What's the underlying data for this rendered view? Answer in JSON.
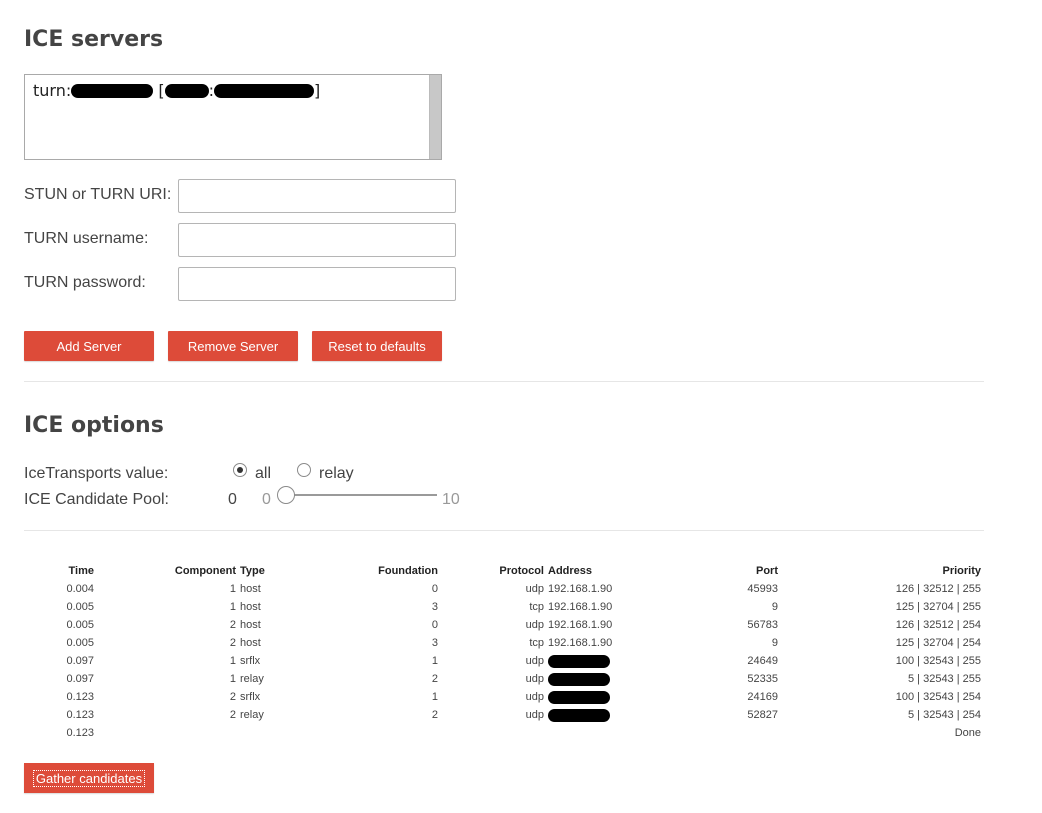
{
  "servers": {
    "title": "ICE servers",
    "list_item": {
      "prefix": "turn:",
      "bracket_open": "[",
      "colon": ":",
      "bracket_close": "]"
    },
    "uri_label": "STUN or TURN URI:",
    "username_label": "TURN username:",
    "password_label": "TURN password:",
    "uri_value": "",
    "username_value": "",
    "password_value": "",
    "add_label": "Add Server",
    "remove_label": "Remove Server",
    "reset_label": "Reset to defaults"
  },
  "options": {
    "title": "ICE options",
    "transports_label": "IceTransports value:",
    "transport_all": "all",
    "transport_relay": "relay",
    "selected_transport": "all",
    "pool_label": "ICE Candidate Pool:",
    "pool_value": "0",
    "slider_min": "0",
    "slider_max": "10",
    "slider_level": 0
  },
  "candidates": {
    "headers": {
      "time": "Time",
      "component": "Component",
      "type": "Type",
      "foundation": "Foundation",
      "protocol": "Protocol",
      "address": "Address",
      "port": "Port",
      "priority": "Priority"
    },
    "rows": [
      {
        "time": "0.004",
        "component": "1",
        "type": "host",
        "foundation": "0",
        "protocol": "udp",
        "address": "192.168.1.90",
        "port": "45993",
        "priority": "126 | 32512 | 255"
      },
      {
        "time": "0.005",
        "component": "1",
        "type": "host",
        "foundation": "3",
        "protocol": "tcp",
        "address": "192.168.1.90",
        "port": "9",
        "priority": "125 | 32704 | 255"
      },
      {
        "time": "0.005",
        "component": "2",
        "type": "host",
        "foundation": "0",
        "protocol": "udp",
        "address": "192.168.1.90",
        "port": "56783",
        "priority": "126 | 32512 | 254"
      },
      {
        "time": "0.005",
        "component": "2",
        "type": "host",
        "foundation": "3",
        "protocol": "tcp",
        "address": "192.168.1.90",
        "port": "9",
        "priority": "125 | 32704 | 254"
      },
      {
        "time": "0.097",
        "component": "1",
        "type": "srflx",
        "foundation": "1",
        "protocol": "udp",
        "address": "",
        "port": "24649",
        "priority": "100 | 32543 | 255"
      },
      {
        "time": "0.097",
        "component": "1",
        "type": "relay",
        "foundation": "2",
        "protocol": "udp",
        "address": "",
        "port": "52335",
        "priority": "5 | 32543 | 255"
      },
      {
        "time": "0.123",
        "component": "2",
        "type": "srflx",
        "foundation": "1",
        "protocol": "udp",
        "address": "",
        "port": "24169",
        "priority": "100 | 32543 | 254"
      },
      {
        "time": "0.123",
        "component": "2",
        "type": "relay",
        "foundation": "2",
        "protocol": "udp",
        "address": "",
        "port": "52827",
        "priority": "5 | 32543 | 254"
      }
    ],
    "done_time": "0.123",
    "done_label": "Done"
  },
  "gather_label": "Gather candidates"
}
